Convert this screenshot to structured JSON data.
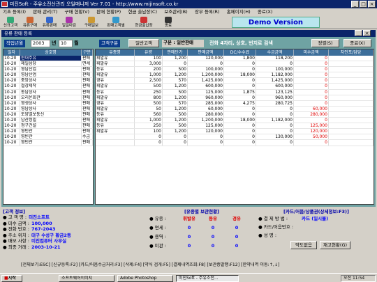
{
  "window": {
    "title": "미진Soft - 주유소전산관리 오일매니저 Ver 7.01 - http://www.mijinsoft.co.kr"
  },
  "menu": [
    "기초 등록(I)",
    "판매 관리(T)",
    "구매 현황(V)",
    "판매 현황(P)",
    "현금 출납장(C)",
    "보조관리(B)",
    "장부 등록(R)",
    "홈페이지(H)",
    "종료(X)"
  ],
  "toolbar": [
    {
      "label": "신규고객",
      "icon": "new-customer-icon",
      "color": "#3a7"
    },
    {
      "label": "유류구매",
      "icon": "fuel-purchase-icon",
      "color": "#c63"
    },
    {
      "label": "유류판매",
      "icon": "fuel-sale-icon",
      "color": "#36c"
    },
    {
      "label": "일일마감",
      "icon": "daily-close-icon",
      "color": "#a3a"
    },
    {
      "label": "구매일보",
      "icon": "purchase-report-icon",
      "color": "#c93"
    },
    {
      "label": "판매고객별",
      "icon": "customer-sales-icon",
      "color": "#39c"
    },
    {
      "label": "현금출납장",
      "icon": "cashbook-icon",
      "color": "#c33"
    },
    {
      "label": "종료",
      "icon": "exit-icon",
      "color": "#333"
    }
  ],
  "demo_banner": "Demo Version",
  "subwindow_title": "유류 판매 등록",
  "filter": {
    "date_label": "작업년월",
    "year": "2003",
    "year_unit": "년",
    "month": "10",
    "month_unit": "월",
    "customer_type_label": "고객구분",
    "customer_type_value": "일반고객",
    "category_label": "구분",
    "category_value": "일반판매",
    "hint": "전화 4자리, 상호, 번지로 검색",
    "sort_button": "정렬(S)",
    "exit_button": "종료(X)"
  },
  "left_grid": {
    "columns": [
      "일자",
      "상호명",
      "구분"
    ],
    "rows": [
      [
        "10-20",
        "현대주유",
        "판매"
      ],
      [
        "10-20",
        "제일삼당",
        "면세"
      ],
      [
        "10-20",
        "영남산업",
        "판매"
      ],
      [
        "10-20",
        "영남산업",
        "판매"
      ],
      [
        "10-20",
        "중앙상사",
        "판매"
      ],
      [
        "10-20",
        "철강제작",
        "판매"
      ],
      [
        "10-20",
        "동남상사",
        "판매"
      ],
      [
        "10-20",
        "오리온회관",
        "판매"
      ],
      [
        "10-20",
        "영생상사",
        "판매"
      ],
      [
        "10-20",
        "영남상사",
        "판매"
      ],
      [
        "10-20",
        "토양열보통신",
        "판매"
      ],
      [
        "10-20",
        "남산정밀",
        "판매"
      ],
      [
        "10-20",
        "정구건설",
        "판매"
      ],
      [
        "10-20",
        "영빈관",
        "판매"
      ],
      [
        "10-20",
        "영빈관",
        "수금"
      ],
      [
        "10-20",
        "영빈관",
        "판매"
      ]
    ],
    "selected_row": 0
  },
  "right_grid": {
    "columns": [
      "유종명",
      "유량",
      "판매단가",
      "판매금액",
      "DC/수수료",
      "수금금액",
      "미수금액",
      "차인포/담당"
    ],
    "rows": [
      [
        "휘발유",
        "100",
        "1,200",
        "120,000",
        "1,800",
        "118,200",
        "0",
        ""
      ],
      [
        "휘발유",
        "3,000",
        "0",
        "0",
        "0",
        "0",
        "0",
        ""
      ],
      [
        "등유",
        "200",
        "500",
        "100,000",
        "0",
        "100,000",
        "0",
        ""
      ],
      [
        "휘발유",
        "1,000",
        "1,200",
        "1,200,000",
        "18,000",
        "1,182,000",
        "0",
        ""
      ],
      [
        "경유",
        "2,500",
        "570",
        "1,425,000",
        "0",
        "1,425,000",
        "0",
        ""
      ],
      [
        "휘발유",
        "500",
        "1,200",
        "600,000",
        "0",
        "600,000",
        "0",
        ""
      ],
      [
        "등유",
        "250",
        "500",
        "125,000",
        "1,875",
        "123,125",
        "0",
        ""
      ],
      [
        "휘발유",
        "800",
        "1,200",
        "960,000",
        "0",
        "960,000",
        "0",
        ""
      ],
      [
        "경유",
        "500",
        "570",
        "285,000",
        "4,275",
        "280,725",
        "0",
        ""
      ],
      [
        "휘발유",
        "50",
        "1,200",
        "60,000",
        "0",
        "0",
        "60,000",
        ""
      ],
      [
        "등유",
        "560",
        "500",
        "280,000",
        "0",
        "0",
        "280,000",
        ""
      ],
      [
        "휘발유",
        "1,000",
        "1,200",
        "1,200,000",
        "18,000",
        "1,182,000",
        "0",
        ""
      ],
      [
        "등유",
        "250",
        "500",
        "125,000",
        "0",
        "0",
        "125,000",
        ""
      ],
      [
        "휘발유",
        "100",
        "1,200",
        "120,000",
        "0",
        "0",
        "120,000",
        ""
      ],
      [
        "",
        "0",
        "0",
        "0",
        "0",
        "130,000",
        "50,000",
        ""
      ],
      [
        "",
        "0",
        "0",
        "0",
        "0",
        "0",
        "0",
        ""
      ]
    ]
  },
  "customer_info": {
    "title": "[고객 정보]",
    "rows": [
      {
        "label": "● 고 객 명 :",
        "value": "미진소프트"
      },
      {
        "label": "● 미수 금액 :",
        "value": "100,000"
      },
      {
        "label": "● 전화 번호 :",
        "value": "767-2043"
      },
      {
        "label": "● 주소 위치 :",
        "value": "대구 수성구 황금2동"
      },
      {
        "label": "● 배모 사항 :",
        "value": "미진컴퓨터 사무실"
      },
      {
        "label": "● 최종 거래 :",
        "value": "2003-10-21"
      }
    ]
  },
  "stock_status": {
    "title": "[유종별 보관현황]",
    "headers": [
      "휘발유",
      "등유",
      "경유"
    ],
    "rows": [
      {
        "label": "● 유종 :",
        "values": [
          "휘발유",
          "등유",
          "경유"
        ]
      },
      {
        "label": "● 면세 :",
        "values": [
          "0",
          "0",
          "0"
        ]
      },
      {
        "label": "● 용역 :",
        "values": [
          "0",
          "0",
          "0"
        ]
      },
      {
        "label": "● 미관 :",
        "values": [
          "0",
          "0",
          "0"
        ]
      }
    ]
  },
  "card_info": {
    "title": "[카드/어음/상품권(상세정보:F3)]",
    "rows": [
      {
        "label": "● 결 제 방 법 :",
        "value": "카드 (일시불)"
      },
      {
        "label": "● 카드/어음번호 :",
        "value": ""
      },
      {
        "label": "● 성       명 :",
        "value": ""
      }
    ],
    "buttons": [
      "약도없음",
      "재고현황(G)"
    ]
  },
  "function_keys": "[전체보기:ESC] [신규등록:F2] [카드/어음수금처리:F3] [삭제:F4] [약식 검개:F5] [결제내역조회:F8] [보관증발행:F12] [한약내역 이동:↑,↓]",
  "taskbar": {
    "start": "시작",
    "tasks": [
      "소프트웨어이미지",
      "Adobe Photoshop",
      "미진Soft - 주유소전..."
    ],
    "clock": "오전 11:54"
  }
}
